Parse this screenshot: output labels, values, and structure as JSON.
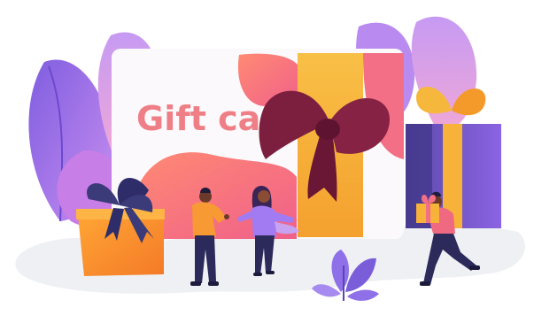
{
  "card": {
    "title": "Gift card"
  },
  "colors": {
    "card_white": "#fbf9fb",
    "title_pink": "#ef7f86",
    "ribbon_gold": "#f6b73d",
    "bow_maroon": "#7c1f3f",
    "coral": "#f36f6a",
    "purple": "#8e62e6",
    "lavender": "#c7a3f2",
    "violet_dark": "#4a3a84",
    "orange": "#f79a33",
    "ground": "#eef0f3"
  },
  "icons": {
    "bow": "bow-icon",
    "gift_box": "gift-box-icon",
    "leaf": "leaf-icon"
  }
}
